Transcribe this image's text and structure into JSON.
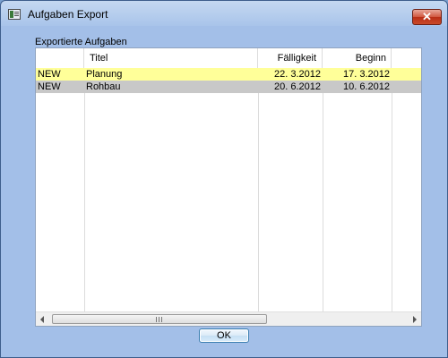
{
  "window": {
    "title": "Aufgaben Export",
    "close_glyph": "✕",
    "icon": "app-window-icon"
  },
  "group": {
    "label": "Exportierte Aufgaben"
  },
  "table": {
    "columns": [
      "",
      "Titel",
      "Fälligkeit",
      "Beginn"
    ],
    "rows": [
      {
        "status": "NEW",
        "title": "Planung",
        "due": "22.  3.2012",
        "start": "17.  3.2012",
        "highlight": "#ffff99"
      },
      {
        "status": "NEW",
        "title": "Rohbau",
        "due": "20.  6.2012",
        "start": "10.  6.2012",
        "highlight": "#c8c8c8"
      }
    ]
  },
  "buttons": {
    "ok": "OK"
  },
  "colors": {
    "window_frame": "#a3bfe8",
    "close_button": "#c94a2a",
    "row_selected_yellow": "#ffff99",
    "row_selected_gray": "#c8c8c8"
  }
}
